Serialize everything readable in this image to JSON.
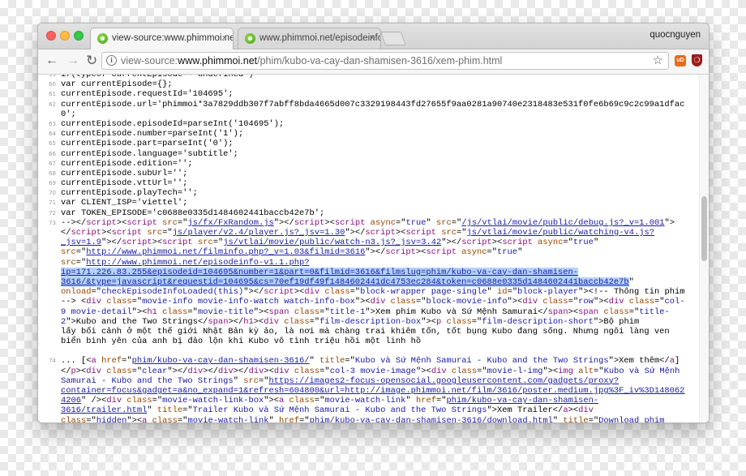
{
  "window": {
    "tabs": [
      {
        "label": "view-source:www.phimmoi.net/"
      },
      {
        "label": "www.phimmoi.net/episodeinfo-v1.1.php"
      }
    ],
    "tab_close": "×",
    "profile_name": "quocnguyen"
  },
  "toolbar": {
    "back_glyph": "←",
    "forward_glyph": "→",
    "reload_glyph": "↻",
    "info_glyph": "i",
    "url_scheme": "view-source:",
    "url_host": "www.phimmoi.net",
    "url_path": "/phim/kubo-va-cay-dan-shamisen-3616/xem-phim.html",
    "star_glyph": "☆",
    "ext1_label": "uD",
    "ext2_label": "❍"
  },
  "colors": {
    "tag": "#881280",
    "attr_name": "#994500",
    "attr_value": "#1a1aa6",
    "selection": "#b3d4fc"
  },
  "source": {
    "lines": [
      {
        "n": "59",
        "s": [
          [
            "p",
            "if(typeof currentEpisode==\"undefined\")"
          ]
        ]
      },
      {
        "n": "60",
        "s": [
          [
            "p",
            "var currentEpisode={};"
          ]
        ]
      },
      {
        "n": "61",
        "s": [
          [
            "p",
            "currentEpisode.requestId='104695';"
          ]
        ]
      },
      {
        "n": "62",
        "s": [
          [
            "p",
            "currentEpisode.url='phimmoi*3a7829ddb307f7abff8bda4665d007c3329198443fd27655f9aa0281a90740e2318483e531f0fe6b69c9c2c99a1dfac"
          ]
        ]
      },
      {
        "n": "",
        "s": [
          [
            "p",
            "0';"
          ]
        ]
      },
      {
        "n": "63",
        "s": [
          [
            "p",
            "currentEpisode.episodeId=parseInt('104695');"
          ]
        ]
      },
      {
        "n": "64",
        "s": [
          [
            "p",
            "currentEpisode.number=parseInt('1');"
          ]
        ]
      },
      {
        "n": "65",
        "s": [
          [
            "p",
            "currentEpisode.part=parseInt('0');"
          ]
        ]
      },
      {
        "n": "66",
        "s": [
          [
            "p",
            "currentEpisode.language='subtitle';"
          ]
        ]
      },
      {
        "n": "67",
        "s": [
          [
            "p",
            "currentEpisode.edition='';"
          ]
        ]
      },
      {
        "n": "68",
        "s": [
          [
            "p",
            "currentEpisode.subUrl='';"
          ]
        ]
      },
      {
        "n": "69",
        "s": [
          [
            "p",
            "currentEpisode.vttUrl='';"
          ]
        ]
      },
      {
        "n": "70",
        "s": [
          [
            "p",
            "currentEpisode.playTech='';"
          ]
        ]
      },
      {
        "n": "71",
        "s": [
          [
            "p",
            "var CLIENT_ISP='viettel';"
          ]
        ]
      },
      {
        "n": "72",
        "s": [
          [
            "p",
            "var TOKEN_EPISODE='c0688e0335d1484602441baccb42e7b';"
          ]
        ]
      },
      {
        "n": "73",
        "s": [
          [
            "p",
            "--></"
          ],
          [
            "t",
            "script"
          ],
          [
            "p",
            "><"
          ],
          [
            "t",
            "script "
          ],
          [
            "a",
            "src"
          ],
          [
            "p",
            "=\""
          ],
          [
            "l",
            "js/fx/FxRandom.js"
          ],
          [
            "p",
            "\"></"
          ],
          [
            "t",
            "script"
          ],
          [
            "p",
            "><"
          ],
          [
            "t",
            "script "
          ],
          [
            "a",
            "async"
          ],
          [
            "p",
            "=\""
          ],
          [
            "v",
            "true"
          ],
          [
            "p",
            "\" "
          ],
          [
            "a",
            "src"
          ],
          [
            "p",
            "=\""
          ],
          [
            "l",
            "/js/vtlai/movie/public/debug.js?_v=1.001"
          ],
          [
            "p",
            "\">"
          ]
        ]
      },
      {
        "n": "",
        "s": [
          [
            "p",
            "</"
          ],
          [
            "t",
            "script"
          ],
          [
            "p",
            "><"
          ],
          [
            "t",
            "script "
          ],
          [
            "a",
            "src"
          ],
          [
            "p",
            "=\""
          ],
          [
            "l",
            "js/player/v2.4/player.js?_jsv=1.30"
          ],
          [
            "p",
            "\"></"
          ],
          [
            "t",
            "script"
          ],
          [
            "p",
            "><"
          ],
          [
            "t",
            "script "
          ],
          [
            "a",
            "src"
          ],
          [
            "p",
            "=\""
          ],
          [
            "l",
            "js/vtlai/movie/public/watching-v4.js?"
          ]
        ]
      },
      {
        "n": "",
        "s": [
          [
            "l",
            "_jsv=1.9"
          ],
          [
            "p",
            "\"></"
          ],
          [
            "t",
            "script"
          ],
          [
            "p",
            "><"
          ],
          [
            "t",
            "script "
          ],
          [
            "a",
            "src"
          ],
          [
            "p",
            "=\""
          ],
          [
            "l",
            "js/vtlai/movie/public/watch-n3.js?_jsv=3.42"
          ],
          [
            "p",
            "\"></"
          ],
          [
            "t",
            "script"
          ],
          [
            "p",
            "><"
          ],
          [
            "t",
            "script "
          ],
          [
            "a",
            "async"
          ],
          [
            "p",
            "=\""
          ],
          [
            "v",
            "true"
          ],
          [
            "p",
            "\""
          ]
        ]
      },
      {
        "n": "",
        "s": [
          [
            "a",
            "src"
          ],
          [
            "p",
            "=\""
          ],
          [
            "l",
            "http://www.phimmoi.net/filminfo.php?_v=1.03&filmid=3616"
          ],
          [
            "p",
            "\"></"
          ],
          [
            "t",
            "script"
          ],
          [
            "p",
            "><"
          ],
          [
            "t",
            "script "
          ],
          [
            "a",
            "async"
          ],
          [
            "p",
            "=\""
          ],
          [
            "v",
            "true"
          ],
          [
            "p",
            "\""
          ]
        ]
      },
      {
        "n": "",
        "s": [
          [
            "a",
            "src"
          ],
          [
            "p",
            "=\""
          ],
          [
            "l",
            "http://www.phimmoi.net/episodeinfo-v1.1.php?"
          ]
        ]
      },
      {
        "n": "",
        "s": [
          [
            "h",
            "ip=171.226.83.255&episodeid=104695&number=1&part=0&filmid=3616&filmslug=phim/kubo-va-cay-dan-shamisen-"
          ]
        ]
      },
      {
        "n": "",
        "s": [
          [
            "h",
            "3616/&type=javascript&requestid=104695&cs=70ef19df49f1484602441dc4753ec284&token=c0688e0335d1484602441baccb42e7b"
          ],
          [
            "p",
            "\""
          ]
        ]
      },
      {
        "n": "",
        "s": [
          [
            "a",
            "onload"
          ],
          [
            "p",
            "=\""
          ],
          [
            "v",
            "checkEpisodeInfoLoaded(this)"
          ],
          [
            "p",
            "\"></"
          ],
          [
            "t",
            "script"
          ],
          [
            "p",
            "><"
          ],
          [
            "t",
            "div "
          ],
          [
            "a",
            "class"
          ],
          [
            "p",
            "=\""
          ],
          [
            "v",
            "block-wrapper page-single"
          ],
          [
            "p",
            "\" "
          ],
          [
            "a",
            "id"
          ],
          [
            "p",
            "=\""
          ],
          [
            "v",
            "block-player"
          ],
          [
            "p",
            "\"><!-- Thông tin phim"
          ]
        ]
      },
      {
        "n": "",
        "s": [
          [
            "p",
            "--> <"
          ],
          [
            "t",
            "div "
          ],
          [
            "a",
            "class"
          ],
          [
            "p",
            "=\""
          ],
          [
            "v",
            "movie-info movie-info-watch watch-info-box"
          ],
          [
            "p",
            "\"><"
          ],
          [
            "t",
            "div "
          ],
          [
            "a",
            "class"
          ],
          [
            "p",
            "=\""
          ],
          [
            "v",
            "block-movie-info"
          ],
          [
            "p",
            "\"><"
          ],
          [
            "t",
            "div "
          ],
          [
            "a",
            "class"
          ],
          [
            "p",
            "=\""
          ],
          [
            "v",
            "row"
          ],
          [
            "p",
            "\"><"
          ],
          [
            "t",
            "div "
          ],
          [
            "a",
            "class"
          ],
          [
            "p",
            "=\""
          ],
          [
            "v",
            "col-"
          ]
        ]
      },
      {
        "n": "",
        "s": [
          [
            "v",
            "9 movie-detail"
          ],
          [
            "p",
            "\"><"
          ],
          [
            "t",
            "h1 "
          ],
          [
            "a",
            "class"
          ],
          [
            "p",
            "=\""
          ],
          [
            "v",
            "movie-title"
          ],
          [
            "p",
            "\"><"
          ],
          [
            "t",
            "span "
          ],
          [
            "a",
            "class"
          ],
          [
            "p",
            "=\""
          ],
          [
            "v",
            "title-1"
          ],
          [
            "p",
            "\">Xem phim Kubo và Sứ Mệnh Samurai</"
          ],
          [
            "t",
            "span"
          ],
          [
            "p",
            "><"
          ],
          [
            "t",
            "span "
          ],
          [
            "a",
            "class"
          ],
          [
            "p",
            "=\""
          ],
          [
            "v",
            "title-"
          ]
        ]
      },
      {
        "n": "",
        "s": [
          [
            "v",
            "2"
          ],
          [
            "p",
            "\">Kubo and the Two Strings</"
          ],
          [
            "t",
            "span"
          ],
          [
            "p",
            "></"
          ],
          [
            "t",
            "h1"
          ],
          [
            "p",
            "><"
          ],
          [
            "t",
            "div "
          ],
          [
            "a",
            "class"
          ],
          [
            "p",
            "=\""
          ],
          [
            "v",
            "film-description-box"
          ],
          [
            "p",
            "\"><"
          ],
          [
            "t",
            "p "
          ],
          [
            "a",
            "class"
          ],
          [
            "p",
            "=\""
          ],
          [
            "v",
            "film-description-short"
          ],
          [
            "p",
            "\">Bộ phim"
          ]
        ]
      },
      {
        "n": "",
        "s": [
          [
            "p",
            "lấy bối cảnh ở một thế giới Nhật Bản kỳ ảo, là nơi mà chàng trai khiêm tốn, tốt bụng Kubo đang sống. Nhưng ngôi làng ven"
          ]
        ]
      },
      {
        "n": "",
        "s": [
          [
            "p",
            "biển bình yên của anh bị đảo lộn khi Kubo vô tình triệu hồi một linh hồ"
          ]
        ]
      },
      {
        "n": "",
        "s": [
          [
            "p",
            " "
          ]
        ]
      },
      {
        "n": "74",
        "s": [
          [
            "p",
            "... [<"
          ],
          [
            "t",
            "a "
          ],
          [
            "a",
            "href"
          ],
          [
            "p",
            "=\""
          ],
          [
            "l",
            "phim/kubo-va-cay-dan-shamisen-3616/"
          ],
          [
            "p",
            "\" "
          ],
          [
            "a",
            "title"
          ],
          [
            "p",
            "=\""
          ],
          [
            "v",
            "Kubo và Sứ Mệnh Samurai - Kubo and the Two Strings"
          ],
          [
            "p",
            "\">Xem thêm</"
          ],
          [
            "t",
            "a"
          ],
          [
            "p",
            "]"
          ]
        ]
      },
      {
        "n": "",
        "s": [
          [
            "p",
            "</"
          ],
          [
            "t",
            "p"
          ],
          [
            "p",
            "><"
          ],
          [
            "t",
            "div "
          ],
          [
            "a",
            "class"
          ],
          [
            "p",
            "=\""
          ],
          [
            "v",
            "clear"
          ],
          [
            "p",
            "\"></"
          ],
          [
            "t",
            "div"
          ],
          [
            "p",
            "></"
          ],
          [
            "t",
            "div"
          ],
          [
            "p",
            "></"
          ],
          [
            "t",
            "div"
          ],
          [
            "p",
            "><"
          ],
          [
            "t",
            "div "
          ],
          [
            "a",
            "class"
          ],
          [
            "p",
            "=\""
          ],
          [
            "v",
            "col-3 movie-image"
          ],
          [
            "p",
            "\"><"
          ],
          [
            "t",
            "div "
          ],
          [
            "a",
            "class"
          ],
          [
            "p",
            "=\""
          ],
          [
            "v",
            "movie-l-img"
          ],
          [
            "p",
            "\"><"
          ],
          [
            "t",
            "img "
          ],
          [
            "a",
            "alt"
          ],
          [
            "p",
            "=\""
          ],
          [
            "v",
            "Kubo và Sứ Mệnh"
          ]
        ]
      },
      {
        "n": "",
        "s": [
          [
            "v",
            "Samurai - Kubo and the Two Strings"
          ],
          [
            "p",
            "\" "
          ],
          [
            "a",
            "src"
          ],
          [
            "p",
            "=\""
          ],
          [
            "l",
            "https://images2-focus-opensocial.googleusercontent.com/gadgets/proxy?"
          ]
        ]
      },
      {
        "n": "",
        "s": [
          [
            "l",
            "container=focus&gadget=a&no_expand=1&refresh=604800&url=http://image.phimmoi.net/film/3616/poster.medium.jpg%3F_iv%3D148062"
          ]
        ]
      },
      {
        "n": "",
        "s": [
          [
            "l",
            "4206"
          ],
          [
            "p",
            "\" /><"
          ],
          [
            "t",
            "div "
          ],
          [
            "a",
            "class"
          ],
          [
            "p",
            "=\""
          ],
          [
            "v",
            "movie-watch-link-box"
          ],
          [
            "p",
            "\"><"
          ],
          [
            "t",
            "a "
          ],
          [
            "a",
            "class"
          ],
          [
            "p",
            "=\""
          ],
          [
            "v",
            "movie-watch-link"
          ],
          [
            "p",
            "\" "
          ],
          [
            "a",
            "href"
          ],
          [
            "p",
            "=\""
          ],
          [
            "l",
            "phim/kubo-va-cay-dan-shamisen-"
          ]
        ]
      },
      {
        "n": "",
        "s": [
          [
            "l",
            "3616/trailer.html"
          ],
          [
            "p",
            "\" "
          ],
          [
            "a",
            "title"
          ],
          [
            "p",
            "=\""
          ],
          [
            "v",
            "Trailer Kubo và Sứ Mệnh Samurai - Kubo and the Two Strings"
          ],
          [
            "p",
            "\">Xem Trailer</"
          ],
          [
            "t",
            "a"
          ],
          [
            "p",
            "><"
          ],
          [
            "t",
            "div"
          ]
        ]
      },
      {
        "n": "",
        "s": [
          [
            "a",
            "class"
          ],
          [
            "p",
            "=\""
          ],
          [
            "v",
            "hidden"
          ],
          [
            "p",
            "\"><"
          ],
          [
            "t",
            "a "
          ],
          [
            "a",
            "class"
          ],
          [
            "p",
            "=\""
          ],
          [
            "v",
            "movie-watch-link"
          ],
          [
            "p",
            "\" "
          ],
          [
            "a",
            "href"
          ],
          [
            "p",
            "=\""
          ],
          [
            "l",
            "phim/kubo-va-cay-dan-shamisen-3616/download.html"
          ],
          [
            "p",
            "\" "
          ],
          [
            "a",
            "title"
          ],
          [
            "p",
            "=\""
          ],
          [
            "v",
            "Download phim"
          ]
        ]
      }
    ]
  }
}
